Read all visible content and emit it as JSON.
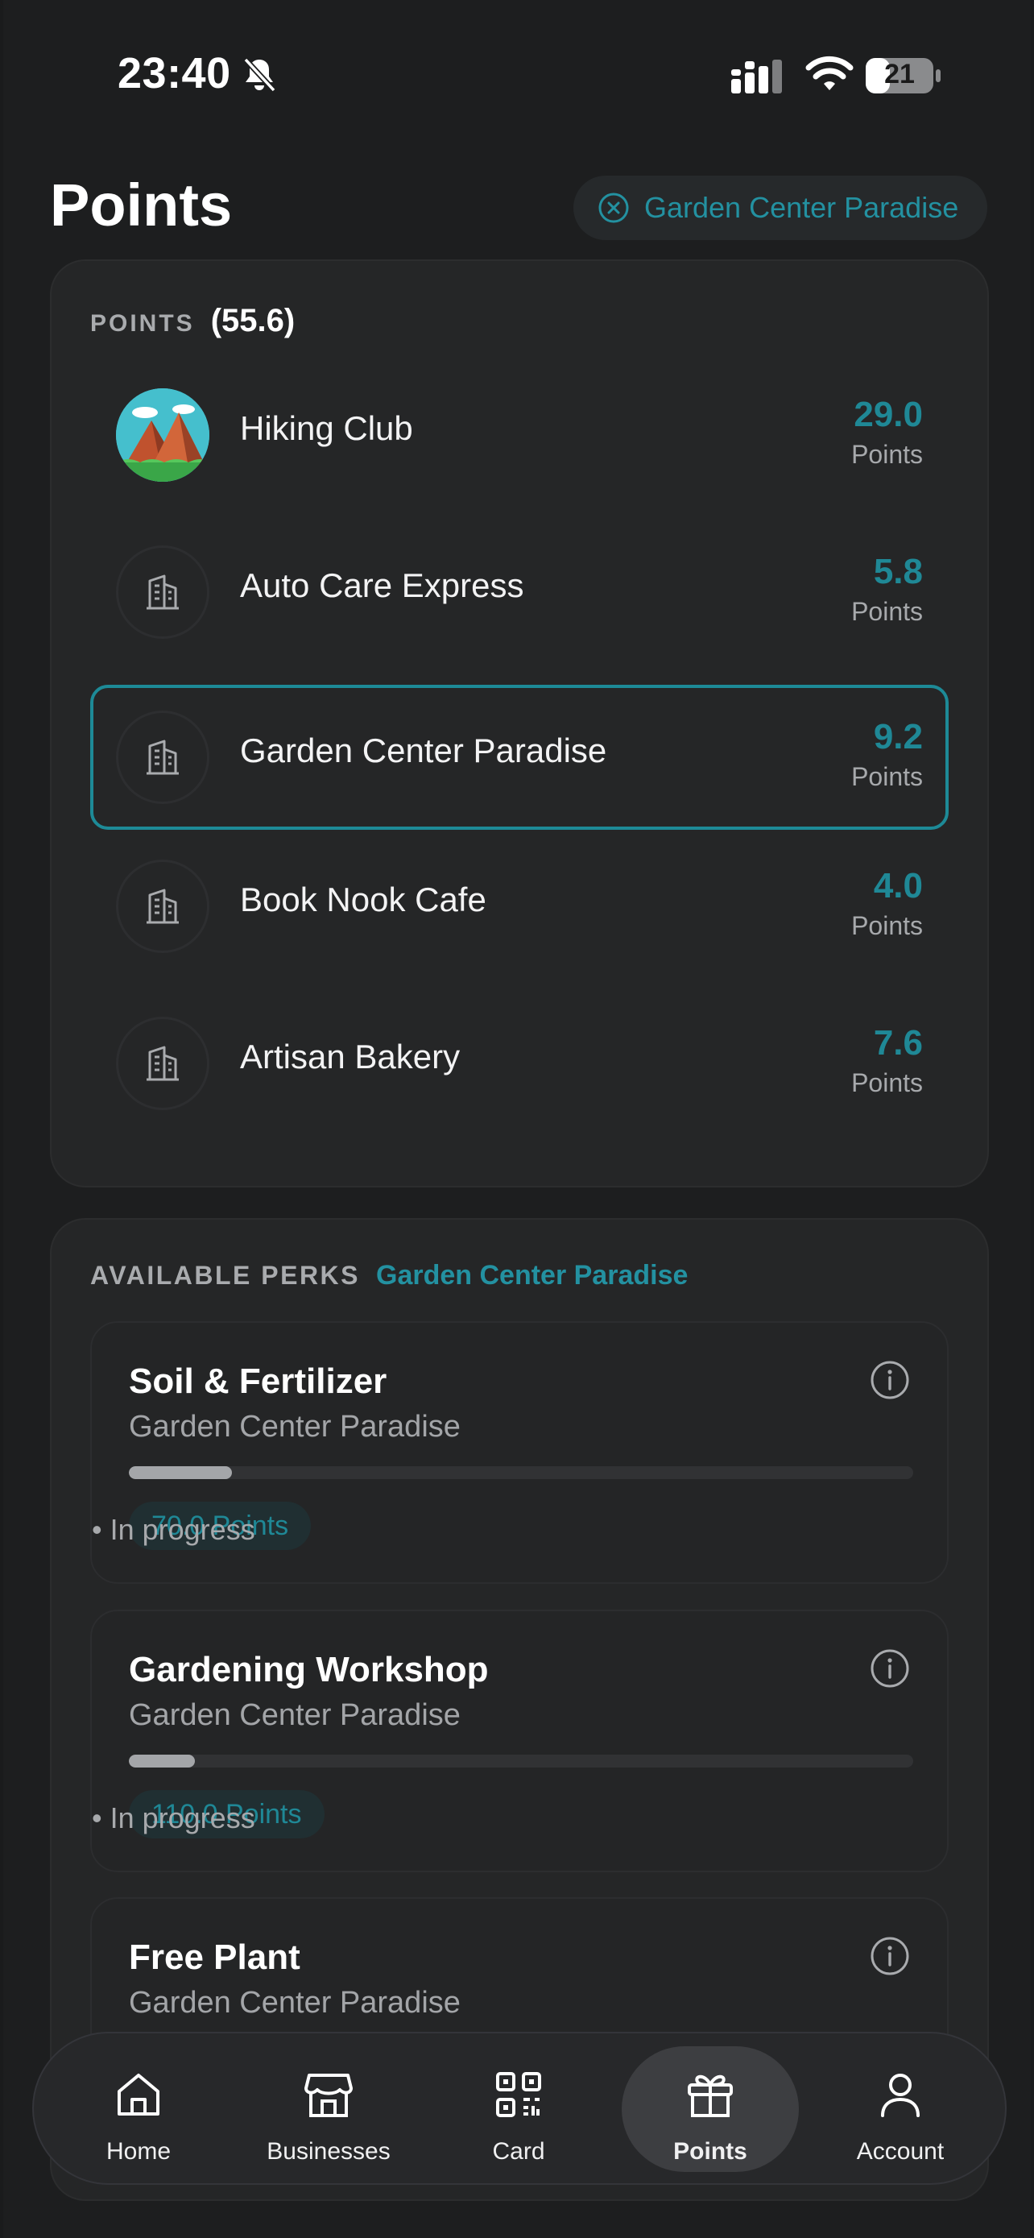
{
  "status_bar": {
    "time": "23:40",
    "battery": "21"
  },
  "header": {
    "title": "Points",
    "filter_chip": "Garden Center Paradise"
  },
  "points": {
    "label": "POINTS",
    "total": "(55.6)",
    "unit": "Points",
    "items": [
      {
        "name": "Hiking Club",
        "value": "29.0",
        "icon": "mountain-logo"
      },
      {
        "name": "Auto Care Express",
        "value": "5.8",
        "icon": "building-icon"
      },
      {
        "name": "Garden Center Paradise",
        "value": "9.2",
        "icon": "building-icon",
        "selected": true
      },
      {
        "name": "Book Nook Cafe",
        "value": "4.0",
        "icon": "building-icon"
      },
      {
        "name": "Artisan Bakery",
        "value": "7.6",
        "icon": "building-icon"
      }
    ]
  },
  "perks": {
    "label": "AVAILABLE PERKS",
    "business": "Garden Center Paradise",
    "items": [
      {
        "title": "Soil & Fertilizer",
        "business": "Garden Center Paradise",
        "cost": "70.0 Points",
        "status": "• In progress",
        "progress": 0.131
      },
      {
        "title": "Gardening Workshop",
        "business": "Garden Center Paradise",
        "cost": "110.0 Points",
        "status": "• In progress",
        "progress": 0.084
      },
      {
        "title": "Free Plant",
        "business": "Garden Center Paradise"
      }
    ]
  },
  "nav": {
    "items": [
      {
        "label": "Home",
        "icon": "home-icon"
      },
      {
        "label": "Businesses",
        "icon": "store-icon"
      },
      {
        "label": "Card",
        "icon": "qr-code-icon"
      },
      {
        "label": "Points",
        "icon": "gift-icon",
        "active": true
      },
      {
        "label": "Account",
        "icon": "user-icon"
      }
    ]
  },
  "colors": {
    "accent": "#1f8896",
    "background": "#1d1e1f",
    "card": "#252627"
  }
}
